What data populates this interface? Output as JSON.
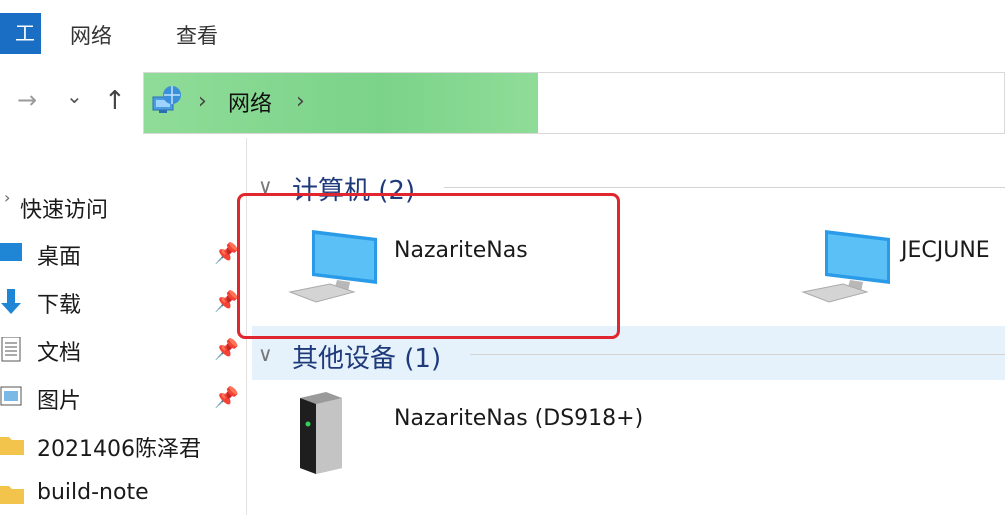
{
  "ribbon": {
    "file_tab": "工",
    "tabs": [
      "网络",
      "查看"
    ]
  },
  "navigation": {
    "forward": "→",
    "recent": "⌄",
    "up": "↑"
  },
  "address": {
    "separator": "›",
    "location": "网络"
  },
  "sidebar": {
    "quick_access": "快速访问",
    "items": [
      {
        "label": "桌面",
        "pinned": true
      },
      {
        "label": "下载",
        "pinned": true
      },
      {
        "label": "文档",
        "pinned": true
      },
      {
        "label": "图片",
        "pinned": true
      },
      {
        "label": "2021406陈泽君",
        "pinned": false
      },
      {
        "label": "build-note",
        "pinned": false
      }
    ]
  },
  "groups": [
    {
      "title": "计算机 (2)",
      "items": [
        "NazariteNas",
        "JECJUNE"
      ]
    },
    {
      "title": "其他设备 (1)",
      "items": [
        "NazariteNas (DS918+)"
      ]
    }
  ],
  "colors": {
    "accent": "#1a6fc4",
    "address_fill": "#7bd389",
    "highlight": "#e0262f",
    "selection_band": "#e5f1fb"
  }
}
